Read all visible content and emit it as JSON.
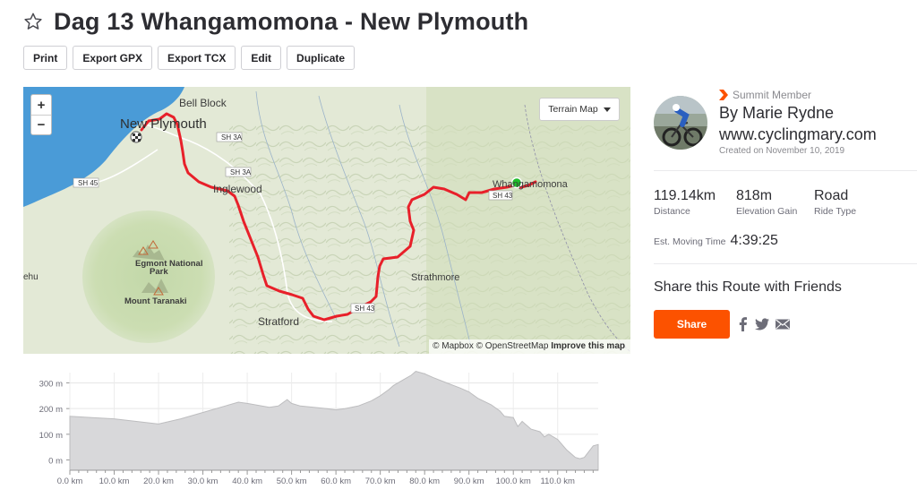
{
  "route": {
    "title": "Dag 13 Whangamomona - New Plymouth"
  },
  "actions": {
    "print": "Print",
    "export_gpx": "Export GPX",
    "export_tcx": "Export TCX",
    "edit": "Edit",
    "duplicate": "Duplicate"
  },
  "map": {
    "zoom_in": "+",
    "zoom_out": "−",
    "style_select": "Terrain Map",
    "labels": {
      "bell_block": "Bell Block",
      "new_plymouth": "New Plymouth",
      "sh3a_1": "SH 3A",
      "sh3a_2": "SH 3A",
      "sh45": "SH 45",
      "inglewood": "Inglewood",
      "egmont_1": "Egmont National",
      "egmont_2": "Park",
      "mount_taranaki": "Mount Taranaki",
      "stratford": "Stratford",
      "strathmore": "Strathmore",
      "whangamomona": "Whangamomona",
      "sh43": "SH 43",
      "sh43_2": "SH 43",
      "ehu": "ehu"
    },
    "attribution": {
      "mapbox": "© Mapbox",
      "osm": "© OpenStreetMap",
      "improve": "Improve this map"
    },
    "colors": {
      "route": "#e8202a",
      "start": "#1fbe2b",
      "sea": "#4a9bd7"
    }
  },
  "elevation": {
    "y_ticks": [
      "300 m",
      "200 m",
      "100 m",
      "0 m"
    ],
    "x_ticks": [
      "0.0 km",
      "10.0 km",
      "20.0 km",
      "30.0 km",
      "40.0 km",
      "50.0 km",
      "60.0 km",
      "70.0 km",
      "80.0 km",
      "90.0 km",
      "100.0 km",
      "110.0 km"
    ]
  },
  "chart_data": {
    "type": "area",
    "title": "",
    "xlabel": "",
    "ylabel": "",
    "xlim": [
      0,
      119.14
    ],
    "ylim": [
      -40,
      340
    ],
    "x_unit": "km",
    "y_unit": "m",
    "grid": true,
    "series": [
      {
        "x": [
          0,
          5,
          10,
          15,
          20,
          25,
          30,
          35,
          38,
          40,
          45,
          47,
          49,
          50,
          52,
          55,
          58,
          60,
          62,
          65,
          68,
          70,
          72,
          73,
          75,
          77,
          78,
          80,
          82,
          85,
          88,
          90,
          92,
          95,
          97,
          98,
          100,
          101,
          102,
          104,
          106,
          107,
          108,
          110,
          112,
          114,
          115,
          116,
          118,
          119.14
        ],
        "y": [
          170,
          165,
          160,
          150,
          140,
          160,
          185,
          210,
          225,
          220,
          205,
          210,
          235,
          220,
          210,
          205,
          200,
          195,
          200,
          210,
          230,
          250,
          275,
          290,
          310,
          330,
          345,
          335,
          320,
          300,
          280,
          265,
          240,
          215,
          190,
          170,
          165,
          130,
          150,
          120,
          110,
          90,
          100,
          80,
          40,
          10,
          5,
          10,
          55,
          60
        ]
      }
    ]
  },
  "author": {
    "badge": "Summit Member",
    "name": "By Marie Rydne",
    "website": "www.cyclingmary.com",
    "created": "Created on November 10, 2019"
  },
  "stats": {
    "distance_value": "119.14km",
    "distance_label": "Distance",
    "elevation_value": "818m",
    "elevation_label": "Elevation Gain",
    "ride_type_value": "Road",
    "ride_type_label": "Ride Type",
    "moving_time_label": "Est. Moving Time",
    "moving_time_value": "4:39:25"
  },
  "share": {
    "heading": "Share this Route with Friends",
    "button": "Share"
  },
  "icons": {
    "star": "star-icon",
    "facebook": "facebook-icon",
    "twitter": "twitter-icon",
    "email": "email-icon"
  },
  "colors": {
    "accent": "#fc5200",
    "text": "#242428",
    "muted": "#6d6d78"
  }
}
